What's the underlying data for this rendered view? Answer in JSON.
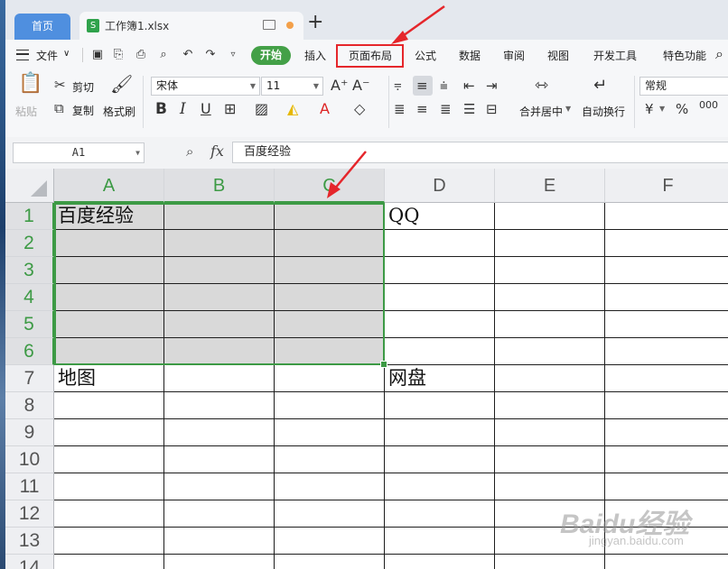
{
  "tabs": {
    "home": "首页",
    "file_icon": "S",
    "file_name": "工作簿1.xlsx",
    "new_tab": "+"
  },
  "menu": {
    "file": "文件",
    "items": [
      "开始",
      "插入",
      "页面布局",
      "公式",
      "数据",
      "审阅",
      "视图",
      "开发工具",
      "特色功能"
    ],
    "highlighted": "页面布局",
    "highlight_color": "#e5262b"
  },
  "ribbon": {
    "paste": "粘贴",
    "cut": "剪切",
    "copy": "复制",
    "format_painter": "格式刷",
    "font_name": "宋体",
    "font_size": "11",
    "merge_center": "合并居中",
    "wrap_text": "自动换行",
    "number_format": "常规",
    "currency_symbol": "¥",
    "percent_symbol": "%",
    "decimal_symbol": "000"
  },
  "formula_bar": {
    "name_box": "A1",
    "fx_label": "fx",
    "content": "百度经验"
  },
  "sheet": {
    "columns": [
      "A",
      "B",
      "C",
      "D",
      "E",
      "F"
    ],
    "selected_columns": [
      "A",
      "B",
      "C"
    ],
    "rows": [
      "1",
      "2",
      "3",
      "4",
      "5",
      "6",
      "7",
      "8",
      "9",
      "10",
      "11",
      "12",
      "13",
      "14"
    ],
    "selected_rows": [
      "1",
      "2",
      "3",
      "4",
      "5",
      "6"
    ],
    "cells": {
      "A1": "百度经验",
      "D1": "QQ",
      "A7": "地图",
      "D7": "网盘"
    },
    "selection": "A1:C6",
    "accent_color": "#3d9a45"
  },
  "watermark": {
    "brand": "Baidu经验",
    "url": "jingyan.baidu.com"
  }
}
